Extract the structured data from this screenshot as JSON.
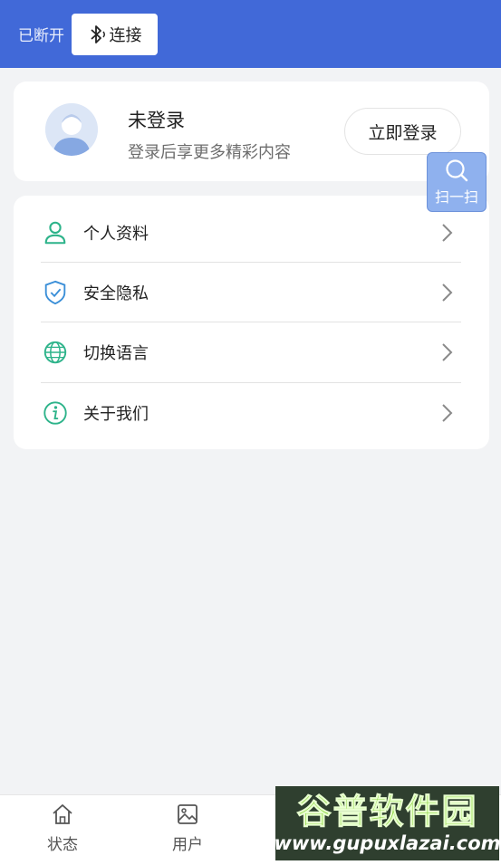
{
  "topbar": {
    "status": "已断开",
    "connect_label": "连接",
    "bg_color": "#4169d8"
  },
  "profile": {
    "name": "未登录",
    "subtitle": "登录后享更多精彩内容",
    "login_label": "立即登录"
  },
  "scan_button": {
    "label": "扫一扫",
    "icon": "search-icon"
  },
  "menu": {
    "items": [
      {
        "label": "个人资料",
        "icon": "user-icon"
      },
      {
        "label": "安全隐私",
        "icon": "shield-icon"
      },
      {
        "label": "切换语言",
        "icon": "globe-icon"
      },
      {
        "label": "关于我们",
        "icon": "info-icon"
      }
    ],
    "accent_color": "#2db38a"
  },
  "tabbar": {
    "tabs": [
      {
        "label": "状态",
        "icon": "home-icon"
      },
      {
        "label": "用户",
        "icon": "image-icon"
      }
    ]
  },
  "watermark": {
    "title": "谷普软件园",
    "url": "www.gupuxlazai.com"
  }
}
